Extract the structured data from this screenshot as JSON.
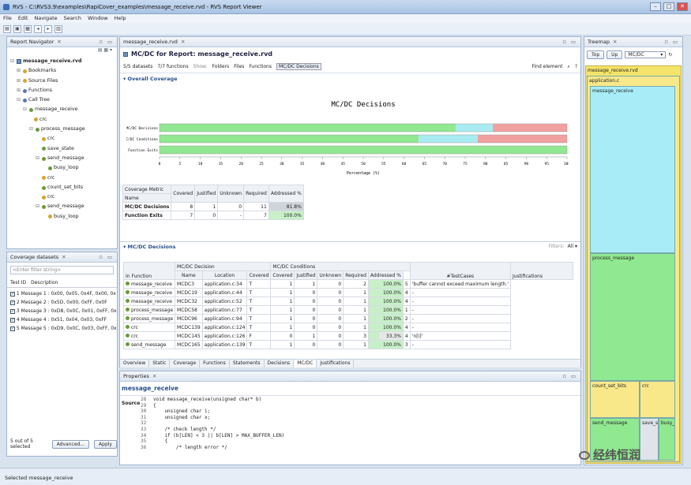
{
  "window": {
    "title": "RVS - C:\\RVS3.9\\examples\\RapiCover_examples\\message_receive.rvd - RVS Report Viewer",
    "minimize": "–",
    "maximize": "□",
    "close": "✕"
  },
  "menu": [
    "File",
    "Edit",
    "Navigate",
    "Search",
    "Window",
    "Help"
  ],
  "navigator": {
    "tab": "Report Navigator",
    "items": [
      {
        "label": "message_receive.rvd",
        "bold": true
      },
      {
        "label": "Bookmarks"
      },
      {
        "label": "Source Files"
      },
      {
        "label": "Functions"
      },
      {
        "label": "Call Tree"
      },
      {
        "label": "message_receive"
      },
      {
        "label": "crc"
      },
      {
        "label": "process_message"
      },
      {
        "label": "crc"
      },
      {
        "label": "save_state"
      },
      {
        "label": "send_message"
      },
      {
        "label": "busy_loop"
      },
      {
        "label": "crc"
      },
      {
        "label": "count_set_bits"
      },
      {
        "label": "crc"
      },
      {
        "label": "send_message"
      },
      {
        "label": "busy_loop"
      }
    ]
  },
  "datasets": {
    "tab": "Coverage datasets",
    "filter_placeholder": "<Enter filter string>",
    "col_id": "Test ID",
    "col_desc": "Description",
    "rows": [
      {
        "id": "1",
        "desc": "Message 1 : 0x00, 0x05, 0x4F, 0x00, 0x"
      },
      {
        "id": "2",
        "desc": "Message 2 : 0x5D, 0x00, 0xFF, 0x0F"
      },
      {
        "id": "3",
        "desc": "Message 3 : 0xD8, 0x0C, 0x01, 0xFF, 0x"
      },
      {
        "id": "4",
        "desc": "Message 4 : 0x51, 0x04, 0x03, 0xFF"
      },
      {
        "id": "5",
        "desc": "Message 5 : 0xD9, 0x0C, 0x03, 0xFF, 0x"
      }
    ],
    "selected": "5 out of 5 selected",
    "advanced": "Advanced...",
    "apply": "Apply"
  },
  "editor": {
    "tab": "message_receive.rvd",
    "header": "MC/DC for Report: message_receive.rvd",
    "toolbar": [
      "5/5 datasets",
      "7/7 functions",
      "Show:",
      "Folders",
      "Files",
      "Functions",
      "MC/DC Decisions"
    ],
    "find": "Find element",
    "overall": "Overall Coverage",
    "bottom_tabs": [
      "Overview",
      "Static",
      "Coverage",
      "Functions",
      "Statements",
      "Decisions",
      "MC/DC",
      "Justifications"
    ]
  },
  "chart_data": {
    "type": "bar",
    "title": "MC/DC Decisions",
    "xlabel": "Percentage (%)",
    "categories": [
      "MC/DC Decisions",
      "MC/DC Conditions",
      "Function Exits"
    ],
    "series": [
      {
        "values": [
          72.7,
          63.6,
          100
        ],
        "color": "#90e890"
      },
      {
        "values": [
          9.1,
          14.5,
          0
        ],
        "color": "#a8ecf2"
      },
      {
        "values": [
          18.2,
          21.9,
          0
        ],
        "color": "#f2a0a0"
      }
    ],
    "xticks": [
      "0",
      "5",
      "10",
      "15",
      "20",
      "25",
      "30",
      "35",
      "40",
      "45",
      "50",
      "55",
      "60",
      "65",
      "70",
      "75",
      "80",
      "85",
      "90",
      "95",
      "100"
    ],
    "xlim": [
      0,
      100
    ],
    "stacked": true
  },
  "metric_table": {
    "headers": [
      "Coverage Metric",
      "Covered",
      "Justified",
      "Unknown",
      "Required",
      "Addressed %"
    ],
    "sub": "Name",
    "rows": [
      [
        "MC/DC Decisions",
        "8",
        "1",
        "0",
        "11",
        "81.8%"
      ],
      [
        "Function Exits",
        "7",
        "0",
        "-",
        "7",
        "100.0%"
      ]
    ]
  },
  "mcdc": {
    "title": "MC/DC Decisions",
    "filters": "Filters:",
    "filter_val": "All",
    "group1": "MC/DC Decision",
    "group2": "MC/DC Conditions",
    "headers": [
      "In Function",
      "Name",
      "Location",
      "Covered",
      "Covered",
      "Justified",
      "Unknown",
      "Required",
      "Addressed %",
      "#TestCases",
      "Justifications"
    ],
    "rows": [
      [
        "message_receive",
        "MCDC3",
        "application.c:34",
        "T",
        "1",
        "1",
        "0",
        "2",
        "100.0%",
        "5",
        "'buffer cannot exceed maximum length.'"
      ],
      [
        "message_receive",
        "MCDC19",
        "application.c:44",
        "T",
        "1",
        "0",
        "0",
        "1",
        "100.0%",
        "4",
        "-"
      ],
      [
        "message_receive",
        "MCDC32",
        "application.c:52",
        "T",
        "1",
        "0",
        "0",
        "1",
        "100.0%",
        "4",
        "-"
      ],
      [
        "process_message",
        "MCDC58",
        "application.c:77",
        "T",
        "1",
        "0",
        "0",
        "1",
        "100.0%",
        "1",
        "-"
      ],
      [
        "process_message",
        "MCDC96",
        "application.c:94",
        "T",
        "1",
        "0",
        "0",
        "1",
        "100.0%",
        "2",
        "-"
      ],
      [
        "crc",
        "MCDC139",
        "application.c:124",
        "T",
        "1",
        "0",
        "0",
        "1",
        "100.0%",
        "4",
        "-"
      ],
      [
        "crc",
        "MCDC145",
        "application.c:126",
        "F",
        "0",
        "1",
        "0",
        "3",
        "33.3%",
        "4",
        "'n[i]'"
      ],
      [
        "send_message",
        "MCDC165",
        "application.c:139",
        "T",
        "1",
        "0",
        "0",
        "1",
        "100.0%",
        "3",
        "-"
      ]
    ]
  },
  "properties": {
    "tab": "Properties",
    "title": "message_receive",
    "source_label": "Source",
    "lines": [
      {
        "n": "28",
        "t": "void message_receive(unsigned char* b)"
      },
      {
        "n": "29",
        "t": "{"
      },
      {
        "n": "30",
        "t": "    unsigned char i;"
      },
      {
        "n": "31",
        "t": "    unsigned char x;"
      },
      {
        "n": "32",
        "t": ""
      },
      {
        "n": "33",
        "t": "    /* check length */"
      },
      {
        "n": "34",
        "t": "    if (b[LEN] < 3 || b[LEN] > MAX_BUFFER_LEN)"
      },
      {
        "n": "35",
        "t": "    {"
      },
      {
        "n": "36",
        "t": "        /* length error */"
      }
    ]
  },
  "treemap": {
    "tab": "Treemap",
    "top": "Top",
    "up": "Up",
    "mode": "MC/DC",
    "root": "message_receive.rvd",
    "app": "application.c",
    "cells": [
      "message_receive",
      "process_message",
      "count_set_bits",
      "crc",
      "send_message",
      "save_sta",
      "busy_"
    ]
  },
  "status": {
    "text": "Selected message_receive"
  },
  "watermark": "经纬恒润"
}
